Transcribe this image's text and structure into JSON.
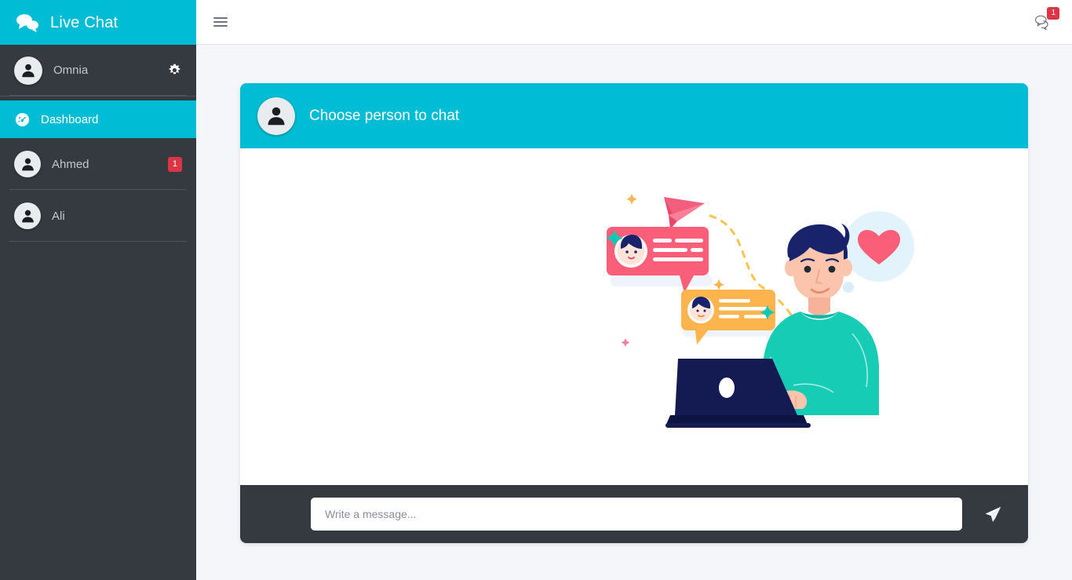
{
  "brand": {
    "title": "Live Chat",
    "icon": "chat-bubbles-icon"
  },
  "sidebar": {
    "user": {
      "name": "Omnia",
      "avatar_icon": "user-avatar-icon",
      "settings_icon": "gear-icon"
    },
    "nav": [
      {
        "label": "Dashboard",
        "icon": "tachometer-icon",
        "active": true
      }
    ],
    "chats": [
      {
        "name": "Ahmed",
        "avatar_icon": "user-avatar-icon",
        "badge": "1"
      },
      {
        "name": "Ali",
        "avatar_icon": "user-avatar-icon",
        "badge": ""
      }
    ]
  },
  "topbar": {
    "menu_toggle_icon": "hamburger-icon",
    "notifications_icon": "comments-icon",
    "notifications_count": "1"
  },
  "chat": {
    "header_title": "Choose person to chat",
    "header_avatar_icon": "user-avatar-icon",
    "illustration_name": "person-chatting-on-laptop-illustration",
    "input_placeholder": "Write a message...",
    "input_value": "",
    "send_icon": "paper-plane-icon"
  },
  "colors": {
    "accent": "#00bcd4",
    "sidebar_bg": "#343a40",
    "page_bg": "#f4f6f9",
    "badge_red": "#dc3545",
    "sidebar_text": "#c2c7d0"
  }
}
